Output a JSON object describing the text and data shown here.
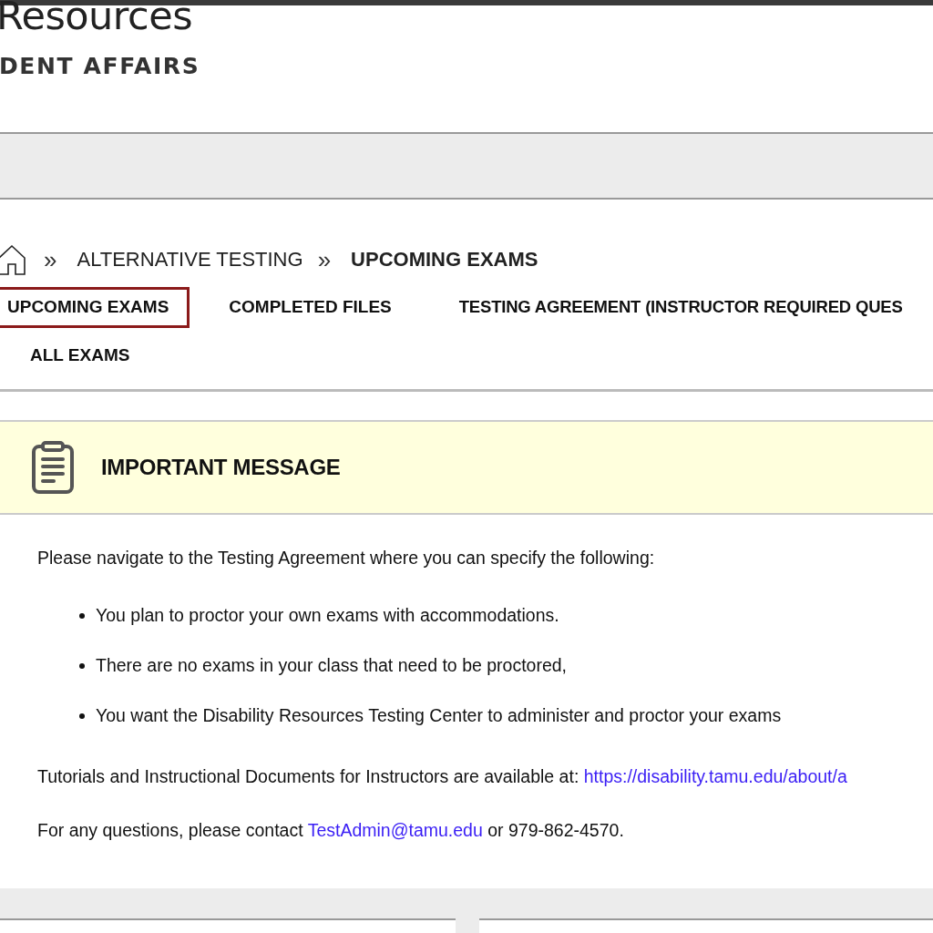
{
  "header": {
    "title": "Resources",
    "subtitle": "DENT AFFAIRS"
  },
  "breadcrumb": [
    {
      "label": "ALTERNATIVE TESTING",
      "current": false
    },
    {
      "label": "UPCOMING EXAMS",
      "current": true
    }
  ],
  "separator": "»",
  "tabs": [
    {
      "label": "UPCOMING EXAMS",
      "selected": true
    },
    {
      "label": "COMPLETED FILES",
      "selected": false
    },
    {
      "label": "TESTING AGREEMENT (INSTRUCTOR REQUIRED QUES",
      "selected": false
    },
    {
      "label": "ALL EXAMS",
      "selected": false
    }
  ],
  "message": {
    "title": "IMPORTANT MESSAGE",
    "intro": "Please navigate to the Testing Agreement where you can specify the following:",
    "bullets": [
      "You plan to proctor your own exams with accommodations.",
      "There are no exams in your class that need to be proctored,",
      "You want the Disability Resources Testing Center to administer and proctor your exams"
    ],
    "tutorials": {
      "text": "Tutorials and Instructional Documents for Instructors are available at:",
      "link": "https://disability.tamu.edu/about/a"
    },
    "contact": {
      "text": "For any questions, please contact",
      "email": "TestAdmin@tamu.edu",
      "after": "or 979-862-4570."
    }
  }
}
